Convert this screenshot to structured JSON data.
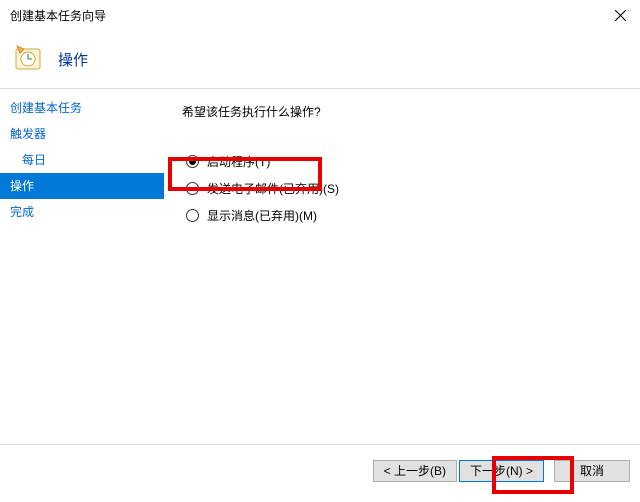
{
  "window": {
    "title": "创建基本任务向导"
  },
  "header": {
    "title": "操作"
  },
  "sidebar": {
    "items": [
      {
        "label": "创建基本任务",
        "indent": false,
        "active": false
      },
      {
        "label": "触发器",
        "indent": false,
        "active": false
      },
      {
        "label": "每日",
        "indent": true,
        "active": false
      },
      {
        "label": "操作",
        "indent": false,
        "active": true
      },
      {
        "label": "完成",
        "indent": false,
        "active": false
      }
    ]
  },
  "main": {
    "prompt": "希望该任务执行什么操作?",
    "options": [
      {
        "label": "启动程序(T)",
        "checked": true
      },
      {
        "label": "发送电子邮件(已弃用)(S)",
        "checked": false
      },
      {
        "label": "显示消息(已弃用)(M)",
        "checked": false
      }
    ]
  },
  "footer": {
    "back": "< 上一步(B)",
    "next": "下一步(N) >",
    "cancel": "取消"
  }
}
